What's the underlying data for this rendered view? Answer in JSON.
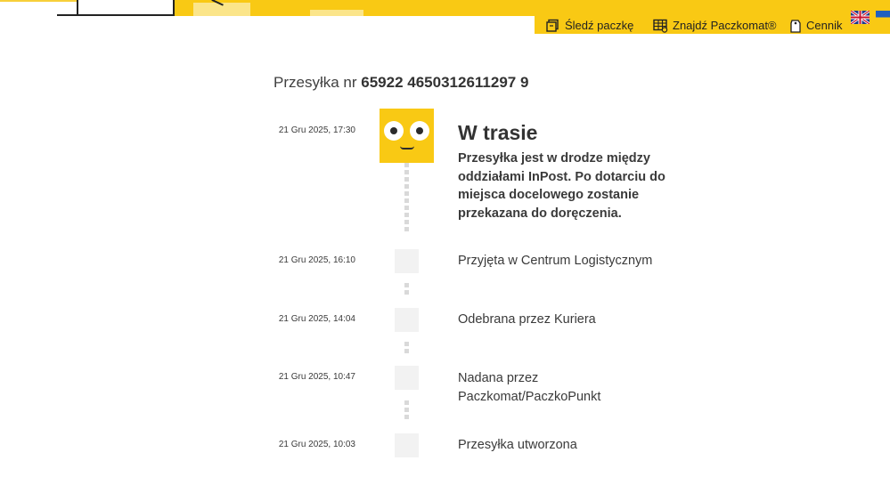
{
  "nav": {
    "track_label": "Śledź paczkę",
    "find_label": "Znajdź Paczkomat®",
    "price_label": "Cennik",
    "lang_en": "English",
    "lang_ua": "Українська"
  },
  "shipment": {
    "prefix": "Przesyłka nr",
    "number": "65922 4650312611297 9"
  },
  "current": {
    "time": "21 Gru 2025, 17:30",
    "title": "W trasie",
    "description": "Przesyłka jest w drodze między oddziałami InPost. Po dotarciu do miejsca docelowego zostanie przekazana do doręczenia."
  },
  "events": [
    {
      "time": "21 Gru 2025, 16:10",
      "label": "Przyjęta w Centrum Logistycznym"
    },
    {
      "time": "21 Gru 2025, 14:04",
      "label": "Odebrana przez Kuriera"
    },
    {
      "time": "21 Gru 2025, 10:47",
      "label": "Nadana przez Paczkomat/PaczkoPunkt"
    },
    {
      "time": "21 Gru 2025, 10:03",
      "label": "Przesyłka utworzona"
    }
  ],
  "colors": {
    "brand_yellow": "#f9c914",
    "event_square": "#f2f2f2"
  }
}
